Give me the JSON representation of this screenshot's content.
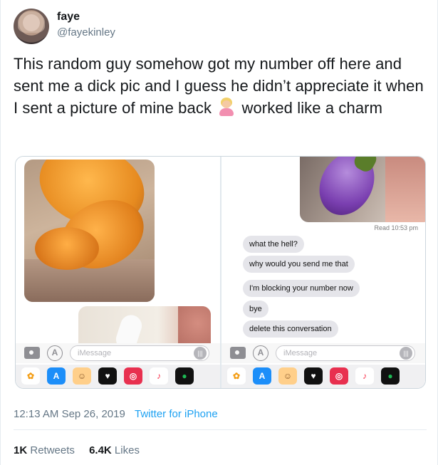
{
  "user": {
    "name": "faye",
    "handle": "@fayekinley"
  },
  "tweet": {
    "text_before_emoji": "This random guy somehow got my number off here and sent me a dick pic and I guess he didn’t appreciate it when I sent a picture of mine back ",
    "text_after_emoji": " worked like a charm",
    "emoji": "woman-shrugging-emoji"
  },
  "screenshot": {
    "read_receipt": "Read 10:53 pm",
    "messages": [
      "what the hell?",
      "why would you send me that",
      "I'm blocking your number now",
      "bye",
      "delete this conversation"
    ],
    "imessage_placeholder": "iMessage"
  },
  "meta": {
    "time": "12:13 AM",
    "date": "Sep 26, 2019",
    "source": "Twitter for iPhone"
  },
  "stats": {
    "retweets_count": "1K",
    "retweets_label": "Retweets",
    "likes_count": "6.4K",
    "likes_label": "Likes"
  },
  "colors": {
    "link": "#1da1f2",
    "secondary_text": "#657786",
    "bubble": "#e5e5ea"
  }
}
